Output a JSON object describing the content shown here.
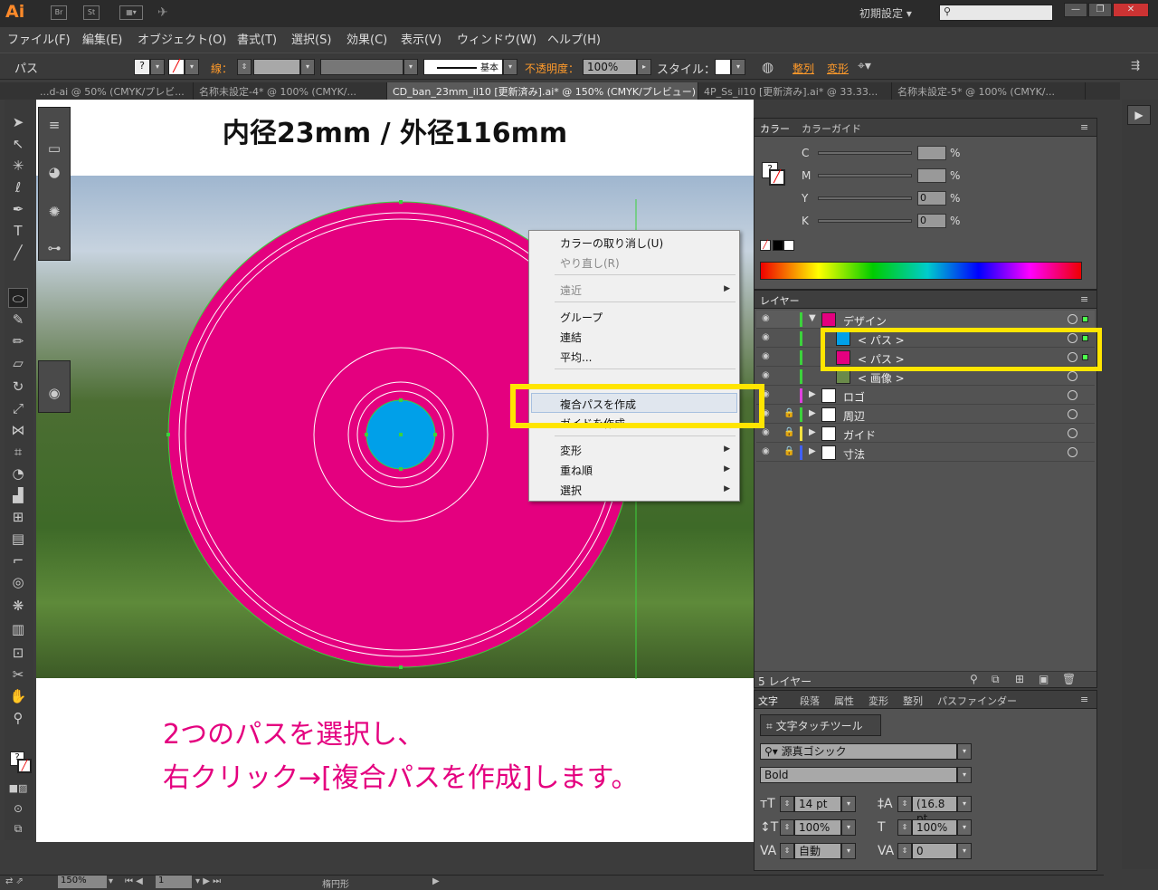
{
  "app": {
    "logo": "Ai",
    "bridge": "Br",
    "stock": "St",
    "workspace": "初期設定"
  },
  "menubar": [
    "ファイル(F)",
    "編集(E)",
    "オブジェクト(O)",
    "書式(T)",
    "選択(S)",
    "効果(C)",
    "表示(V)",
    "ウィンドウ(W)",
    "ヘルプ(H)"
  ],
  "control": {
    "object_type": "パス",
    "stroke_label": "線：",
    "brush_label": "基本",
    "opacity_label": "不透明度：",
    "opacity_value": "100%",
    "style_label": "スタイル：",
    "align_label": "整列",
    "transform_label": "変形"
  },
  "tabs": [
    {
      "label": "...d-ai @ 50% (CMYK/プレビ...",
      "active": false
    },
    {
      "label": "名称未設定-4* @ 100% (CMYK/...",
      "active": false
    },
    {
      "label": "CD_ban_23mm_il10 [更新済み].ai* @ 150% (CMYK/プレビュー)",
      "active": true
    },
    {
      "label": "4P_Ss_il10 [更新済み].ai* @ 33.33...",
      "active": false
    },
    {
      "label": "名称未設定-5* @ 100% (CMYK/...",
      "active": false
    }
  ],
  "canvas": {
    "heading": "内径23mm / 外径116mm",
    "instruction_line1": "2つのパスを選択し、",
    "instruction_line2": "右クリック→[複合パスを作成]します。"
  },
  "context_menu": [
    {
      "label": "カラーの取り消し(U)",
      "disabled": false,
      "submenu": false
    },
    {
      "label": "やり直し(R)",
      "disabled": true,
      "submenu": false
    },
    {
      "label": "遠近",
      "disabled": true,
      "submenu": true
    },
    {
      "label": "グループ",
      "disabled": false,
      "submenu": false
    },
    {
      "label": "連結",
      "disabled": false,
      "submenu": false
    },
    {
      "label": "平均...",
      "disabled": false,
      "submenu": false
    },
    {
      "label": "複合パスを作成",
      "disabled": false,
      "submenu": false
    },
    {
      "label": "ガイドを作成",
      "disabled": false,
      "submenu": false
    },
    {
      "label": "変形",
      "disabled": false,
      "submenu": true
    },
    {
      "label": "重ね順",
      "disabled": false,
      "submenu": true
    },
    {
      "label": "選択",
      "disabled": false,
      "submenu": true
    }
  ],
  "color_panel": {
    "tabs": [
      "カラー",
      "カラーガイド"
    ],
    "channels": [
      {
        "label": "C",
        "value": ""
      },
      {
        "label": "M",
        "value": ""
      },
      {
        "label": "Y",
        "value": "0"
      },
      {
        "label": "K",
        "value": "0"
      }
    ],
    "percent": "%"
  },
  "layers_panel": {
    "title": "レイヤー",
    "rows": [
      {
        "name": "デザイン",
        "bar": "#3cd23c",
        "thumb": "#e4007f",
        "lock": false,
        "expanded": true,
        "indent": false
      },
      {
        "name": "< パス >",
        "bar": "#3cd23c",
        "thumb": "#00a0e9",
        "lock": false,
        "expanded": false,
        "indent": true
      },
      {
        "name": "< パス >",
        "bar": "#3cd23c",
        "thumb": "#e4007f",
        "lock": false,
        "expanded": false,
        "indent": true
      },
      {
        "name": "< 画像 >",
        "bar": "#3cd23c",
        "thumb": "#6a8a4a",
        "lock": false,
        "expanded": false,
        "indent": true
      },
      {
        "name": "ロゴ",
        "bar": "#e040e0",
        "thumb": "#ffffff",
        "lock": false,
        "expanded": false,
        "indent": false
      },
      {
        "name": "周辺",
        "bar": "#3cd23c",
        "thumb": "#ffffff",
        "lock": true,
        "expanded": false,
        "indent": false
      },
      {
        "name": "ガイド",
        "bar": "#f0e040",
        "thumb": "#ffffff",
        "lock": true,
        "expanded": false,
        "indent": false
      },
      {
        "name": "寸法",
        "bar": "#4060ff",
        "thumb": "#ffffff",
        "lock": true,
        "expanded": false,
        "indent": false
      }
    ],
    "footer": "5 レイヤー"
  },
  "char_panel": {
    "tabs": [
      "文字",
      "段落",
      "属性",
      "変形",
      "整列",
      "パスファインダー"
    ],
    "touch_button": "文字タッチツール",
    "font_family": "源真ゴシック",
    "font_style": "Bold",
    "size": "14 pt",
    "leading": "(16.8 pt",
    "vscale": "100%",
    "hscale": "100%",
    "kerning": "自動",
    "tracking": "0"
  },
  "status": {
    "zoom": "150%",
    "page": "1",
    "tool": "楕円形"
  },
  "colors": {
    "magenta": "#e4007f",
    "cyan": "#00a0e9",
    "highlight": "#ffe500",
    "accent": "#ff9a2a"
  }
}
